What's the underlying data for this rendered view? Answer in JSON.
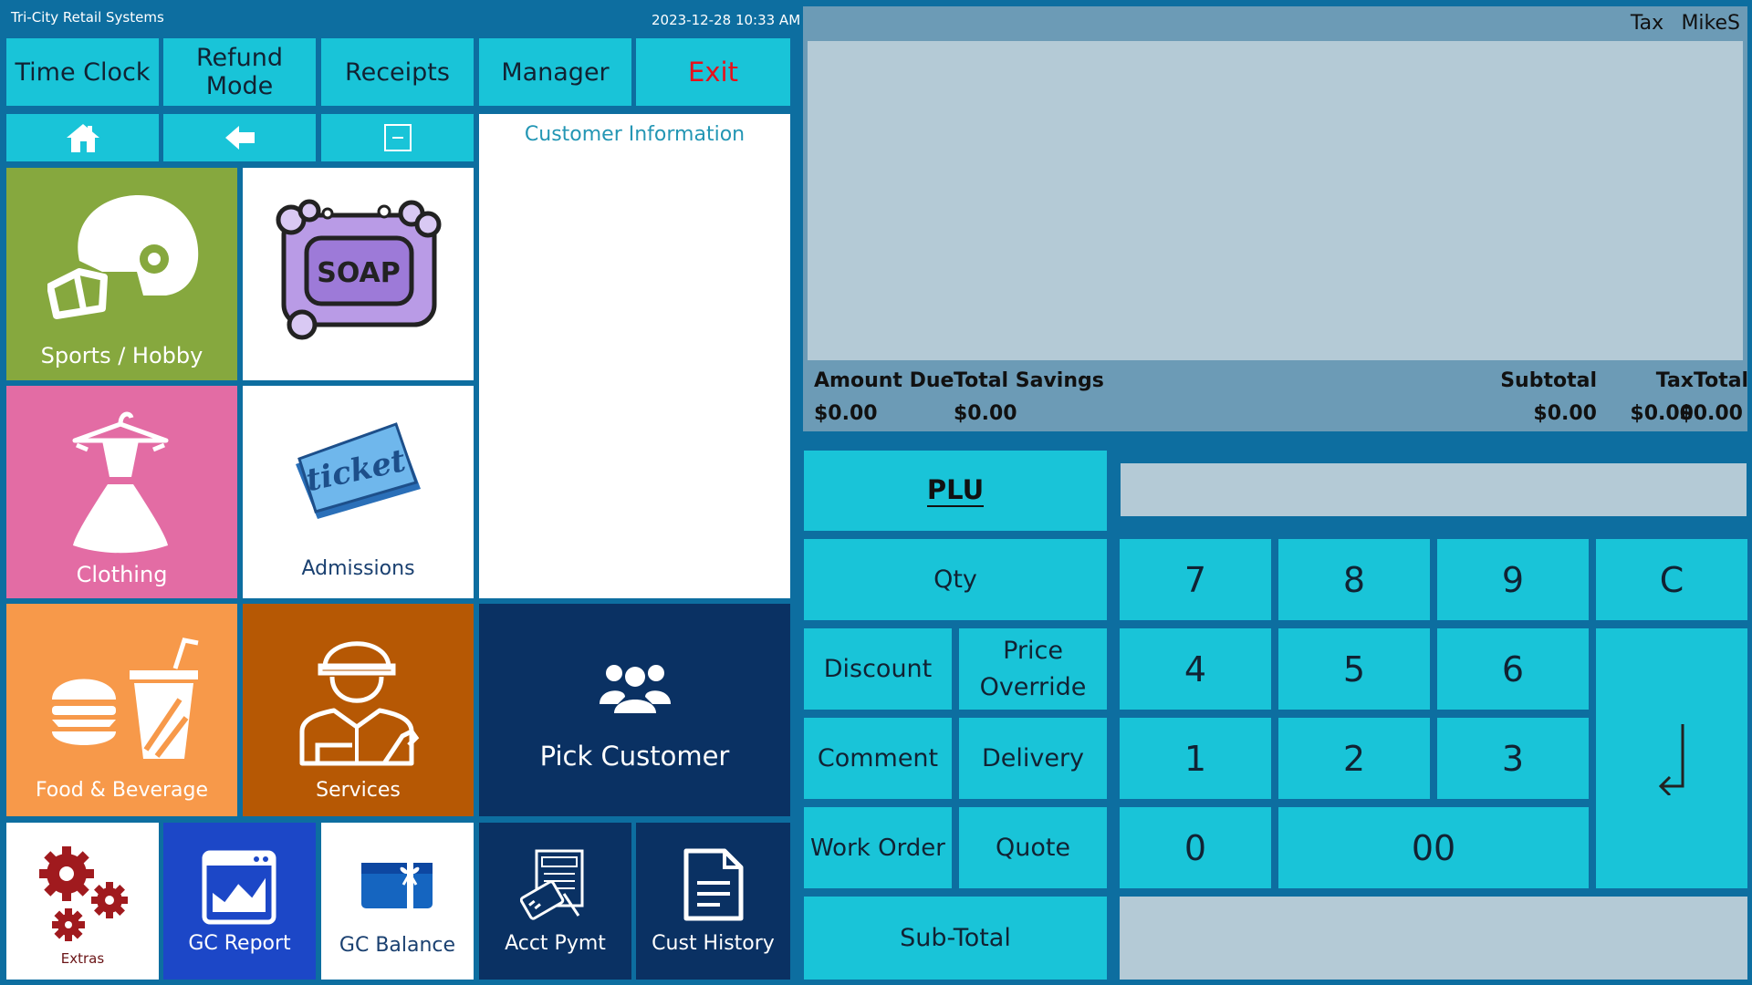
{
  "header": {
    "company": "Tri-City Retail Systems",
    "datetime": "2023-12-28 10:33 AM"
  },
  "top_buttons": {
    "time_clock": "Time Clock",
    "refund_mode": "Refund Mode",
    "receipts": "Receipts",
    "manager": "Manager",
    "exit": "Exit"
  },
  "customer": {
    "title": "Customer Information",
    "pick_label": "Pick Customer"
  },
  "tiles": {
    "sports": "Sports / Hobby",
    "soap_text": "SOAP",
    "clothing": "Clothing",
    "ticket_text": "ticket",
    "admissions": "Admissions",
    "food": "Food & Beverage",
    "services": "Services",
    "extras": "Extras",
    "gc_report": "GC Report",
    "gc_balance": "GC Balance",
    "acct_pymt": "Acct Pymt",
    "cust_history": "Cust History"
  },
  "receipt_header": {
    "tax": "Tax",
    "user": "MikeS"
  },
  "totals": {
    "amount_due_label": "Amount Due",
    "amount_due": "$0.00",
    "total_savings_label": "Total Savings",
    "total_savings": "$0.00",
    "subtotal_label": "Subtotal",
    "subtotal": "$0.00",
    "tax_label": "Tax",
    "tax": "$0.00",
    "total_label": "Total",
    "total": "$0.00"
  },
  "keypad": {
    "plu": "PLU",
    "qty": "Qty",
    "discount": "Discount",
    "price_override_1": "Price",
    "price_override_2": "Override",
    "comment": "Comment",
    "delivery": "Delivery",
    "work_order": "Work Order",
    "quote": "Quote",
    "subtotal": "Sub-Total",
    "k7": "7",
    "k8": "8",
    "k9": "9",
    "clear": "C",
    "k4": "4",
    "k5": "5",
    "k6": "6",
    "k1": "1",
    "k2": "2",
    "k3": "3",
    "k0": "0",
    "k00": "00"
  },
  "colors": {
    "cyan": "#19c4d8",
    "sports": "#86a83e",
    "clothing": "#e36ca4",
    "food": "#f7994a",
    "services": "#b65804",
    "navy": "#0a3163",
    "gc_report": "#1c47c7",
    "exit": "#e8101a"
  }
}
